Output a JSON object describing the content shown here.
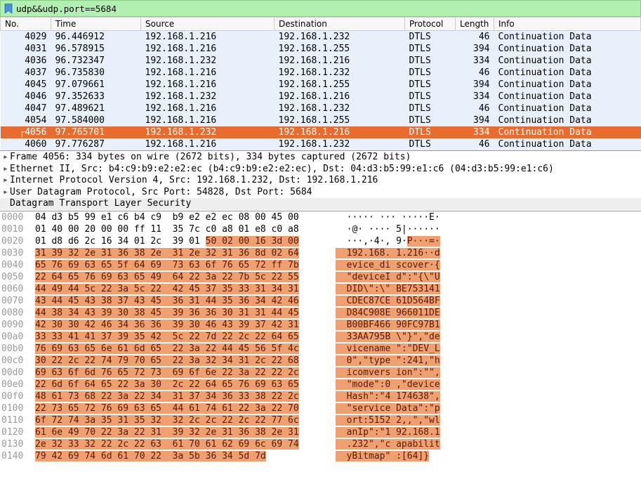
{
  "filter": {
    "text": "udp&&udp.port==5684"
  },
  "columns": {
    "no": "No.",
    "time": "Time",
    "src": "Source",
    "dst": "Destination",
    "proto": "Protocol",
    "len": "Length",
    "info": "Info"
  },
  "packets": [
    {
      "no": "4029",
      "time": "96.446912",
      "src": "192.168.1.216",
      "dst": "192.168.1.232",
      "proto": "DTLS",
      "len": "46",
      "info": "Continuation Data",
      "sel": false
    },
    {
      "no": "4031",
      "time": "96.578915",
      "src": "192.168.1.216",
      "dst": "192.168.1.255",
      "proto": "DTLS",
      "len": "394",
      "info": "Continuation Data",
      "sel": false
    },
    {
      "no": "4036",
      "time": "96.732347",
      "src": "192.168.1.232",
      "dst": "192.168.1.216",
      "proto": "DTLS",
      "len": "334",
      "info": "Continuation Data",
      "sel": false
    },
    {
      "no": "4037",
      "time": "96.735830",
      "src": "192.168.1.216",
      "dst": "192.168.1.232",
      "proto": "DTLS",
      "len": "46",
      "info": "Continuation Data",
      "sel": false
    },
    {
      "no": "4045",
      "time": "97.079661",
      "src": "192.168.1.216",
      "dst": "192.168.1.255",
      "proto": "DTLS",
      "len": "394",
      "info": "Continuation Data",
      "sel": false
    },
    {
      "no": "4046",
      "time": "97.352633",
      "src": "192.168.1.232",
      "dst": "192.168.1.216",
      "proto": "DTLS",
      "len": "334",
      "info": "Continuation Data",
      "sel": false
    },
    {
      "no": "4047",
      "time": "97.489621",
      "src": "192.168.1.216",
      "dst": "192.168.1.232",
      "proto": "DTLS",
      "len": "46",
      "info": "Continuation Data",
      "sel": false
    },
    {
      "no": "4054",
      "time": "97.584000",
      "src": "192.168.1.216",
      "dst": "192.168.1.255",
      "proto": "DTLS",
      "len": "394",
      "info": "Continuation Data",
      "sel": false
    },
    {
      "no": "4056",
      "time": "97.765701",
      "src": "192.168.1.232",
      "dst": "192.168.1.216",
      "proto": "DTLS",
      "len": "334",
      "info": "Continuation Data",
      "sel": true
    },
    {
      "no": "4060",
      "time": "97.776287",
      "src": "192.168.1.216",
      "dst": "192.168.1.232",
      "proto": "DTLS",
      "len": "46",
      "info": "Continuation Data",
      "sel": false
    }
  ],
  "details": [
    "Frame 4056: 334 bytes on wire (2672 bits), 334 bytes captured (2672 bits)",
    "Ethernet II, Src: b4:c9:b9:e2:e2:ec (b4:c9:b9:e2:e2:ec), Dst: 04:d3:b5:99:e1:c6 (04:d3:b5:99:e1:c6)",
    "Internet Protocol Version 4, Src: 192.168.1.232, Dst: 192.168.1.216",
    "User Datagram Protocol, Src Port: 54828, Dst Port: 5684",
    "Datagram Transport Layer Security"
  ],
  "hex": [
    {
      "off": "0000",
      "b1": "04 d3 b5 99 e1 c6 b4 c9 ",
      "b2": " b9 e2 e2 ec 08 00 45 00",
      "a": "  ····· ··· ·····E·",
      "hl": 0
    },
    {
      "off": "0010",
      "b1": "01 40 00 20 00 00 ff 11 ",
      "b2": " 35 7c c0 a8 01 e8 c0 a8",
      "a": "  ·@· ···· 5|······",
      "hl": 0
    },
    {
      "off": "0020",
      "b1": "01 d8 d6 2c 16 34 01 2c ",
      "b2": " 39 01 ",
      "b2h": "50 02 00 16 3d 00",
      "a": "  ···,·4·, 9·",
      "ah": "P···=·",
      "hl": 1
    },
    {
      "off": "0030",
      "b1h": "31 39 32 2e 31 36 38 2e ",
      "b2h": " 31 2e 32 31 36 8d 02 64",
      "ah": "  192.168. 1.216··d",
      "hl": 2
    },
    {
      "off": "0040",
      "b1h": "65 76 69 63 65 5f 64 69 ",
      "b2h": " 73 63 6f 76 65 72 ff 7b",
      "ah": "  evice_di scover·{",
      "hl": 2
    },
    {
      "off": "0050",
      "b1h": "22 64 65 76 69 63 65 49 ",
      "b2h": " 64 22 3a 22 7b 5c 22 55",
      "ah": "  \"deviceI d\":\"{\\\"U",
      "hl": 2
    },
    {
      "off": "0060",
      "b1h": "44 49 44 5c 22 3a 5c 22 ",
      "b2h": " 42 45 37 35 33 31 34 31",
      "ah": "  DID\\\":\\\" BE753141",
      "hl": 2
    },
    {
      "off": "0070",
      "b1h": "43 44 45 43 38 37 43 45 ",
      "b2h": " 36 31 44 35 36 34 42 46",
      "ah": "  CDEC87CE 61D564BF",
      "hl": 2
    },
    {
      "off": "0080",
      "b1h": "44 38 34 43 39 30 38 45 ",
      "b2h": " 39 36 36 30 31 31 44 45",
      "ah": "  D84C908E 966011DE",
      "hl": 2
    },
    {
      "off": "0090",
      "b1h": "42 30 30 42 46 34 36 36 ",
      "b2h": " 39 30 46 43 39 37 42 31",
      "ah": "  B00BF466 90FC97B1",
      "hl": 2
    },
    {
      "off": "00a0",
      "b1h": "33 33 41 41 37 39 35 42 ",
      "b2h": " 5c 22 7d 22 2c 22 64 65",
      "ah": "  33AA795B \\\"}\",\"de",
      "hl": 2
    },
    {
      "off": "00b0",
      "b1h": "76 69 63 65 6e 61 6d 65 ",
      "b2h": " 22 3a 22 44 45 56 5f 4c",
      "ah": "  vicename \":\"DEV_L",
      "hl": 2
    },
    {
      "off": "00c0",
      "b1h": "30 22 2c 22 74 79 70 65 ",
      "b2h": " 22 3a 32 34 31 2c 22 68",
      "ah": "  0\",\"type \":241,\"h",
      "hl": 2
    },
    {
      "off": "00d0",
      "b1h": "69 63 6f 6d 76 65 72 73 ",
      "b2h": " 69 6f 6e 22 3a 22 22 2c",
      "ah": "  icomvers ion\":\"\",",
      "hl": 2
    },
    {
      "off": "00e0",
      "b1h": "22 6d 6f 64 65 22 3a 30 ",
      "b2h": " 2c 22 64 65 76 69 63 65",
      "ah": "  \"mode\":0 ,\"device",
      "hl": 2
    },
    {
      "off": "00f0",
      "b1h": "48 61 73 68 22 3a 22 34 ",
      "b2h": " 31 37 34 36 33 38 22 2c",
      "ah": "  Hash\":\"4 174638\",",
      "hl": 2
    },
    {
      "off": "0100",
      "b1h": "22 73 65 72 76 69 63 65 ",
      "b2h": " 44 61 74 61 22 3a 22 70",
      "ah": "  \"service Data\":\"p",
      "hl": 2
    },
    {
      "off": "0110",
      "b1h": "6f 72 74 3a 35 31 35 32 ",
      "b2h": " 32 2c 2c 22 2c 22 77 6c",
      "ah": "  ort:5152 2,,\",\"wl",
      "hl": 2
    },
    {
      "off": "0120",
      "b1h": "61 6e 49 70 22 3a 22 31 ",
      "b2h": " 39 32 2e 31 36 38 2e 31",
      "ah": "  anIp\":\"1 92.168.1",
      "hl": 2
    },
    {
      "off": "0130",
      "b1h": "2e 32 33 32 22 2c 22 63 ",
      "b2h": " 61 70 61 62 69 6c 69 74",
      "ah": "  .232\",\"c apabilit",
      "hl": 2
    },
    {
      "off": "0140",
      "b1h": "79 42 69 74 6d 61 70 22 ",
      "b2h": " 3a 5b 36 34 5d 7d",
      "ah": "  yBitmap\" :[64]}",
      "hl": 2
    }
  ]
}
